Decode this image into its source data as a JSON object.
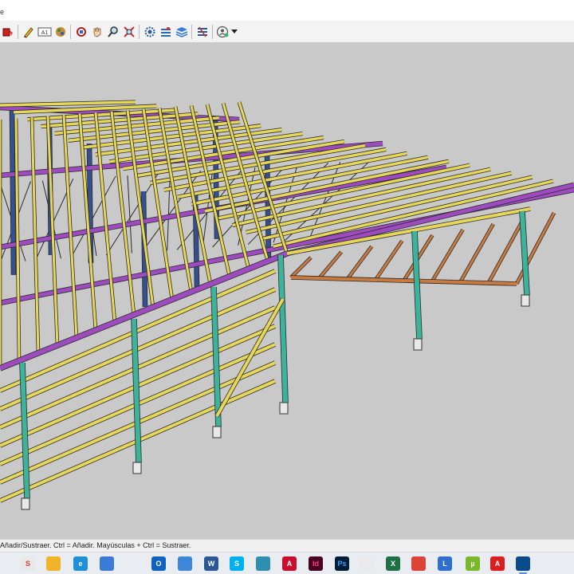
{
  "window": {
    "title_fragment": "e"
  },
  "toolbar": {
    "buttons": [
      {
        "name": "paint-bucket-icon"
      },
      {
        "name": "pencil-icon"
      },
      {
        "name": "text-tag-icon",
        "glyph": "A1"
      },
      {
        "name": "materials-icon"
      },
      {
        "name": "orbit-icon"
      },
      {
        "name": "pan-hand-icon"
      },
      {
        "name": "zoom-icon"
      },
      {
        "name": "zoom-extents-icon"
      },
      {
        "name": "gear-settings-icon"
      },
      {
        "name": "styles-icon"
      },
      {
        "name": "layers-icon"
      },
      {
        "name": "warehouse-icon"
      },
      {
        "name": "user-profile-icon"
      },
      {
        "name": "chevron-down-icon"
      }
    ]
  },
  "status": {
    "message": "Añadir/Sustraer. Ctrl = Añadir. Mayúsculas + Ctrl = Sustraer."
  },
  "taskbar": {
    "apps": [
      {
        "name": "app-s-icon",
        "label": "S",
        "color": "#e8e8e8",
        "fg": "#d03a2b"
      },
      {
        "name": "file-explorer-icon",
        "label": "",
        "color": "#f0b429",
        "fg": "#ffffff"
      },
      {
        "name": "edge-icon",
        "label": "e",
        "color": "#1f8fd8",
        "fg": "#ffffff"
      },
      {
        "name": "monitor-icon",
        "label": "",
        "color": "#3a7bd5",
        "fg": "#ffffff"
      },
      {
        "name": "outlook-icon",
        "label": "O",
        "color": "#0f62c0",
        "fg": "#ffffff"
      },
      {
        "name": "files-icon",
        "label": "",
        "color": "#3d87d9",
        "fg": "#ffffff"
      },
      {
        "name": "word-icon",
        "label": "W",
        "color": "#2b5797",
        "fg": "#ffffff"
      },
      {
        "name": "skype-icon",
        "label": "S",
        "color": "#00aff0",
        "fg": "#ffffff"
      },
      {
        "name": "globe-icon",
        "label": "",
        "color": "#2f8fb0",
        "fg": "#ffffff"
      },
      {
        "name": "autocad-icon",
        "label": "A",
        "color": "#c8102e",
        "fg": "#ffffff"
      },
      {
        "name": "indesign-icon",
        "label": "Id",
        "color": "#49021f",
        "fg": "#ff3d8b"
      },
      {
        "name": "photoshop-icon",
        "label": "Ps",
        "color": "#001e36",
        "fg": "#31a8ff"
      },
      {
        "name": "paint-icon",
        "label": "",
        "color": "#eaeaea",
        "fg": "#555555"
      },
      {
        "name": "excel-icon",
        "label": "X",
        "color": "#1e7145",
        "fg": "#ffffff"
      },
      {
        "name": "chrome-icon",
        "label": "",
        "color": "#db4437",
        "fg": "#ffffff"
      },
      {
        "name": "lumion-icon",
        "label": "L",
        "color": "#2e6fd0",
        "fg": "#ffffff"
      },
      {
        "name": "utorrent-icon",
        "label": "µ",
        "color": "#78b829",
        "fg": "#ffffff"
      },
      {
        "name": "acrobat-icon",
        "label": "A",
        "color": "#dc1e1e",
        "fg": "#ffffff"
      },
      {
        "name": "sketchup-icon",
        "label": "",
        "color": "#0a4c8a",
        "fg": "#ffffff",
        "active": true
      }
    ]
  },
  "colors": {
    "viewport_bg": "#c9c9c9",
    "purlin_yellow": "#e6d75a",
    "rafter_purple": "#9d4bbf",
    "column_green": "#3cb39a",
    "column_blue": "#35508e",
    "canopy_orange": "#c97a3f",
    "brace_black": "#2a2a2a"
  }
}
